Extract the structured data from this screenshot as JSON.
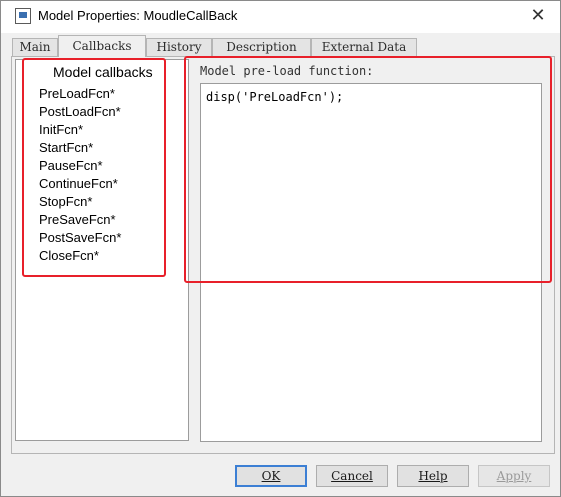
{
  "window": {
    "title": "Model Properties: MoudleCallBack",
    "close_glyph": "✕"
  },
  "tabs": [
    {
      "label": "Main"
    },
    {
      "label": "Callbacks"
    },
    {
      "label": "History"
    },
    {
      "label": "Description"
    },
    {
      "label": "External Data"
    }
  ],
  "active_tab": "Callbacks",
  "callbacks": {
    "title": "Model callbacks",
    "items": [
      "PreLoadFcn*",
      "PostLoadFcn*",
      "InitFcn*",
      "StartFcn*",
      "PauseFcn*",
      "ContinueFcn*",
      "StopFcn*",
      "PreSaveFcn*",
      "PostSaveFcn*",
      "CloseFcn*"
    ]
  },
  "editor": {
    "label": "Model pre-load function:",
    "code": "disp('PreLoadFcn');"
  },
  "buttons": {
    "ok": "OK",
    "cancel": "Cancel",
    "help": "Help",
    "apply": "Apply"
  },
  "colors": {
    "highlight": "#e8202a",
    "default_button_border": "#3c7fd4"
  }
}
